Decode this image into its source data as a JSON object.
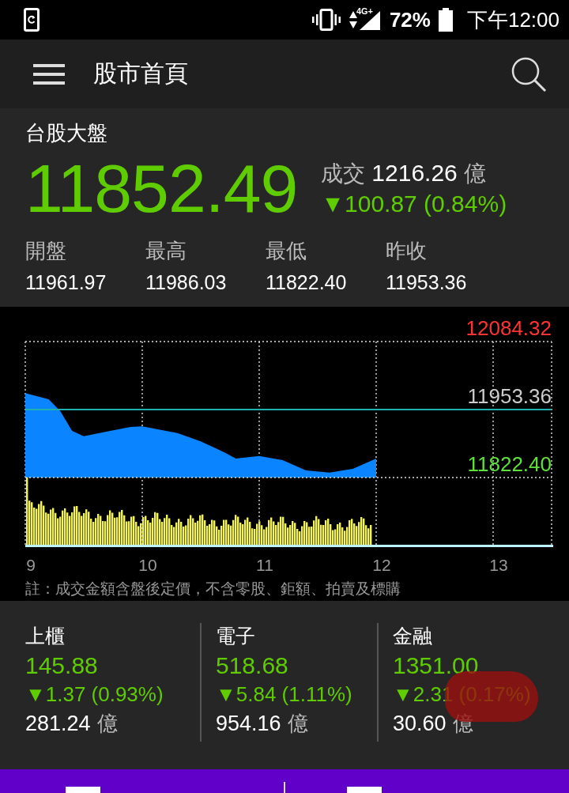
{
  "status_bar": {
    "network": "4G+",
    "battery": "72%",
    "time": "下午12:00"
  },
  "header": {
    "title": "股市首頁"
  },
  "index": {
    "name": "台股大盤",
    "value": "11852.49",
    "volume_label": "成交",
    "volume": "1216.26",
    "volume_unit": "億",
    "change": "▼100.87 (0.84%)",
    "stats": [
      {
        "label": "開盤",
        "value": "11961.97"
      },
      {
        "label": "最高",
        "value": "11986.03"
      },
      {
        "label": "最低",
        "value": "11822.40"
      },
      {
        "label": "昨收",
        "value": "11953.36"
      }
    ]
  },
  "chart": {
    "chart_data": {
      "type": "area",
      "x": [
        9.0,
        9.2,
        9.3,
        9.4,
        9.5,
        9.7,
        9.9,
        10.0,
        10.3,
        10.5,
        10.7,
        10.8,
        11.0,
        11.2,
        11.4,
        11.6,
        11.8,
        12.0
      ],
      "series": [
        {
          "color": "#0a84ff",
          "values": [
            11985,
            11973,
            11950,
            11912,
            11902,
            11911,
            11920,
            11921,
            11908,
            11892,
            11871,
            11859,
            11864,
            11856,
            11836,
            11832,
            11839,
            11859
          ]
        }
      ],
      "grid": true,
      "ref_lines": [
        {
          "axis": "y",
          "value": 11953.36,
          "color": "#1fb0b0"
        }
      ],
      "xlim": [
        9,
        13.5
      ],
      "ylim": [
        11691.4,
        12084.32
      ],
      "xticks": [
        9,
        10,
        11,
        12,
        13
      ],
      "yticks": [
        {
          "value": 12084.32,
          "label": "12084.32"
        },
        {
          "value": 11953.36,
          "label": "11953.36"
        },
        {
          "value": 11822.4,
          "label": "11822.40"
        }
      ]
    },
    "note": "註：成交金額含盤後定價，不含零股、鉅額、拍賣及標購"
  },
  "sectors": [
    {
      "name": "上櫃",
      "value": "145.88",
      "change": "▼1.37 (0.93%)",
      "amount": "281.24",
      "unit": "億",
      "highlighted": false
    },
    {
      "name": "電子",
      "value": "518.68",
      "change": "▼5.84 (1.11%)",
      "amount": "954.16",
      "unit": "億",
      "highlighted": false
    },
    {
      "name": "金融",
      "value": "1351.00",
      "change": "▼2.31 (0.17%)",
      "amount": "30.60",
      "unit": "億",
      "highlighted": true
    }
  ]
}
